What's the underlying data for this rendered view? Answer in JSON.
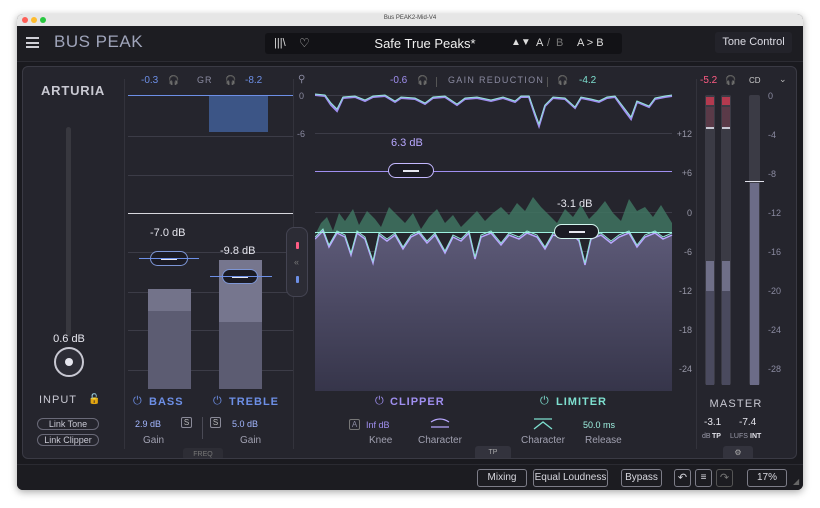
{
  "window": {
    "title": "Bus PEAK2-Mid-V4"
  },
  "header": {
    "app_name": "BUS PEAK",
    "preset": {
      "name": "Safe True Peaks*",
      "nav": "▲▼"
    },
    "ab": {
      "a": "A",
      "slash": "/",
      "b": "B",
      "copy": "A > B"
    },
    "tone_control_label": "Tone Control"
  },
  "input": {
    "brand": "ARTURIA",
    "gain_value": "0.6 dB",
    "label": "INPUT",
    "link_tone": "Link Tone",
    "link_clipper": "Link Clipper"
  },
  "tone": {
    "left_value": "-0.3",
    "right_value": "-8.2",
    "gr_label": "GR",
    "bass": {
      "label": "BASS",
      "handle_value": "-7.0 dB",
      "gain_value": "2.9 dB",
      "gain_label": "Gain",
      "solo": "S"
    },
    "treble": {
      "label": "TREBLE",
      "handle_value": "-9.8 dB",
      "gain_value": "5.0 dB",
      "gain_label": "Gain",
      "solo": "S"
    },
    "freq_label": "FREQ"
  },
  "gain_reduction": {
    "left_value": "-0.6",
    "right_value": "-4.2",
    "label": "GAIN REDUCTION",
    "ticks_top": [
      "0",
      "-6"
    ],
    "clipper_threshold": "6.3 dB",
    "limiter_threshold": "-3.1 dB",
    "right_scale": [
      "+12",
      "+6",
      "0",
      "-6",
      "-12",
      "-18",
      "-24"
    ]
  },
  "clipper": {
    "label": "CLIPPER",
    "a_badge": "A",
    "knee_value": "Inf dB",
    "knee_label": "Knee",
    "character_label": "Character"
  },
  "limiter": {
    "label": "LIMITER",
    "character_label": "Character",
    "release_value": "50.0 ms",
    "release_label": "Release"
  },
  "tp_label": "TP",
  "master": {
    "top_value": "-5.2",
    "cd_label": "CD",
    "label": "MASTER",
    "tp_value": "-3.1",
    "tp_unit": "dB",
    "tp_label": "TP",
    "lufs_value": "-7.4",
    "lufs_unit": "LUFS",
    "lufs_label": "INT",
    "scale": [
      "0",
      "-4",
      "-8",
      "-12",
      "-16",
      "-20",
      "-24",
      "-28"
    ]
  },
  "footer": {
    "mixing": "Mixing",
    "equal_loudness": "Equal Loudness",
    "bypass": "Bypass",
    "zoom": "17%"
  },
  "colors": {
    "accent_blue": "#6d8fe6",
    "accent_violet": "#a08ff0",
    "teal": "#7ee0d0"
  }
}
